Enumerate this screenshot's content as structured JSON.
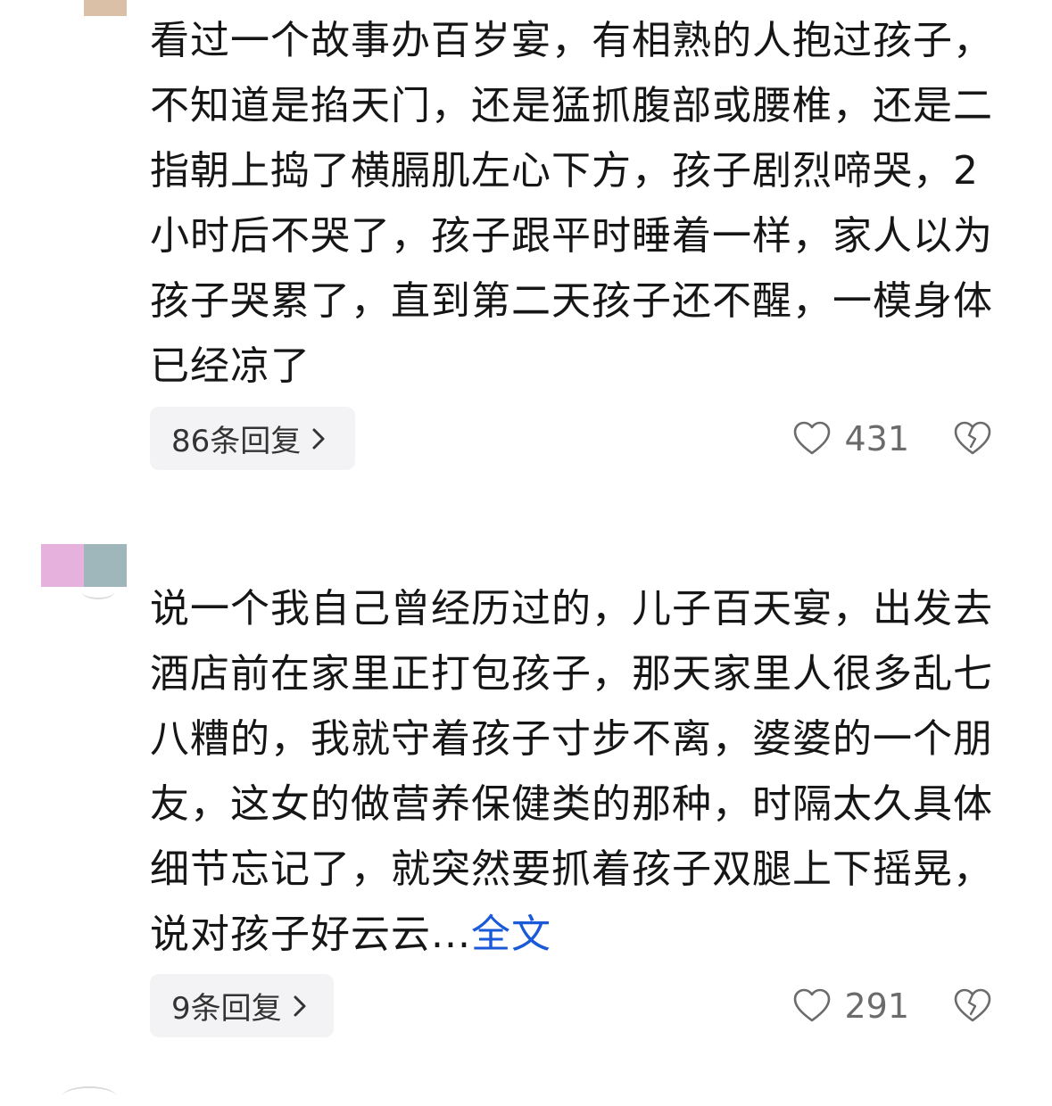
{
  "comments": [
    {
      "avatar_colors": [
        "#ffffff",
        "#d9c0a6"
      ],
      "text": "看过一个故事办百岁宴，有相熟的人抱过孩子，不知道是掐天门，还是猛抓腹部或腰椎，还是二指朝上捣了横膈肌左心下方，孩子剧烈啼哭，2小时后不哭了，孩子跟平时睡着一样，家人以为孩子哭累了，直到第二天孩子还不醒，一模身体已经凉了",
      "more_label": "",
      "reply_label": "86条回复",
      "like_count": "431"
    },
    {
      "avatar_colors": [
        "#e6b1dc",
        "#9fb7bb"
      ],
      "text": "说一个我自己曾经历过的，儿子百天宴，出发去酒店前在家里正打包孩子，那天家里人很多乱七八糟的，我就守着孩子寸步不离，婆婆的一个朋友，这女的做营养保健类的那种，时隔太久具体细节忘记了，就突然要抓着孩子双腿上下摇晃，说对孩子好云云...",
      "more_label": "全文",
      "reply_label": "9条回复",
      "like_count": "291"
    }
  ],
  "icons": {
    "like": "heart-outline-icon",
    "dislike": "broken-heart-icon",
    "chevron": "chevron-right-icon"
  }
}
